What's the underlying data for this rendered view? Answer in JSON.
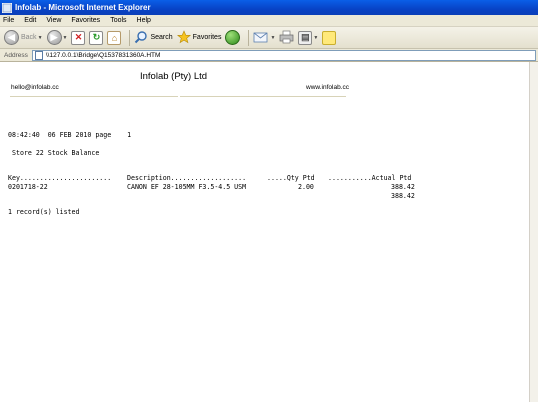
{
  "window": {
    "title": "Infolab - Microsoft Internet Explorer"
  },
  "menu": {
    "items": [
      "File",
      "Edit",
      "View",
      "Favorites",
      "Tools",
      "Help"
    ]
  },
  "toolbar": {
    "back_label": "Back",
    "search_label": "Search",
    "favorites_label": "Favorites"
  },
  "address": {
    "label": "Address",
    "url": "\\\\127.0.0.1\\Bridge\\Q1537831360A.HTM"
  },
  "report": {
    "company": "Infolab (Pty) Ltd",
    "email": "hello@infolab.cc",
    "website": "www.infolab.cc",
    "timestamp_line": "08:42:40  06 FEB 2010 page    1",
    "title": "Store 22 Stock Balance",
    "headers": {
      "key": "Key.......................",
      "description": "Description...................",
      "qty": ".....Qty Ptd",
      "actual": "...........Actual Ptd"
    },
    "rows": [
      {
        "key": "0201718-22",
        "description": "CANON EF 28-105MM F3.5-4.5 USM",
        "qty": "2.00",
        "actual": "388.42"
      }
    ],
    "total": "388.42",
    "footer": "1 record(s) listed"
  },
  "colors": {
    "titlebar": "#0A5FE8",
    "chrome": "#ECE9D8"
  }
}
